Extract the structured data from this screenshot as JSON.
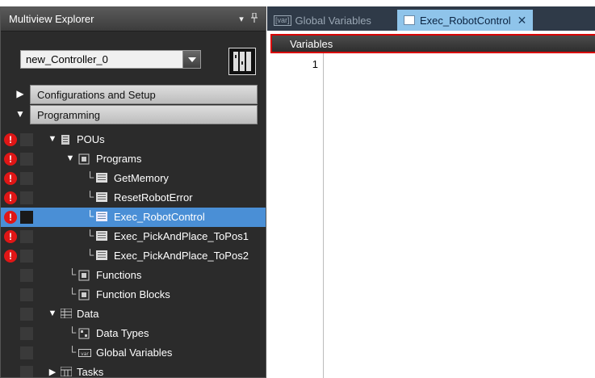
{
  "explorer": {
    "title": "Multiview Explorer",
    "pin_glyph": "▾ ▫",
    "controller": "new_Controller_0"
  },
  "sections": {
    "config": "Configurations and Setup",
    "programming": "Programming"
  },
  "tree": {
    "pous": "POUs",
    "programs": "Programs",
    "program_items": [
      "GetMemory",
      "ResetRobotError",
      "Exec_RobotControl",
      "Exec_PickAndPlace_ToPos1",
      "Exec_PickAndPlace_ToPos2"
    ],
    "functions": "Functions",
    "function_blocks": "Function Blocks",
    "data": "Data",
    "data_types": "Data Types",
    "global_variables": "Global Variables",
    "tasks": "Tasks"
  },
  "tabs": {
    "global_variables": "Global Variables",
    "global_variables_icon": "[var]",
    "exec_robot_control": "Exec_RobotControl",
    "close": "✕"
  },
  "editor": {
    "variables_label": "Variables",
    "line_number": "1"
  },
  "colors": {
    "selection": "#4a8fd6",
    "error": "#e01616",
    "active_tab": "#8fc4ea",
    "highlight_border": "#d90000"
  },
  "icons": {
    "error": "exclamation-circle-icon",
    "pou": "pou-icon",
    "programs": "programs-icon",
    "program": "program-icon",
    "functions": "functions-icon",
    "function_blocks": "function-blocks-icon",
    "data": "data-icon",
    "data_types": "data-types-icon",
    "global_variables": "var-icon",
    "tasks": "tasks-icon"
  }
}
